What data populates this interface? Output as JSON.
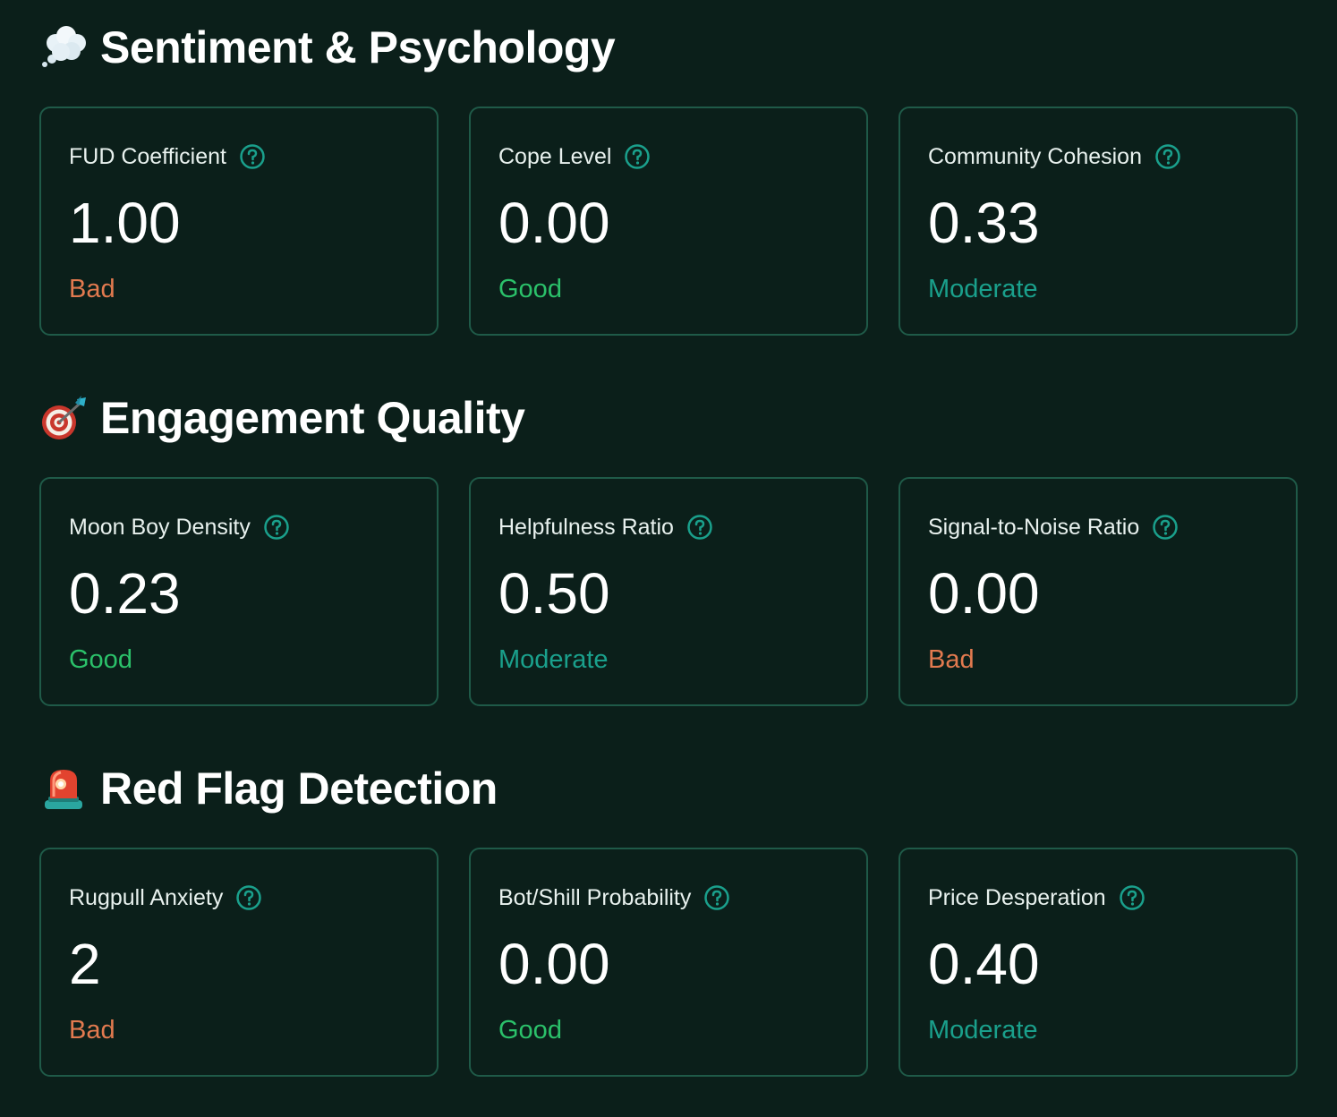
{
  "colors": {
    "background": "#0b1f1a",
    "card_border": "#1f5a48",
    "help_icon": "#1aa08c",
    "status_bad": "#e27a4f",
    "status_good": "#2bc16a",
    "status_moderate": "#1aa08c"
  },
  "sections": [
    {
      "icon": "thought-balloon-icon",
      "title": "Sentiment & Psychology",
      "cards": [
        {
          "label": "FUD Coefficient",
          "value": "1.00",
          "status": "Bad",
          "status_type": "bad"
        },
        {
          "label": "Cope Level",
          "value": "0.00",
          "status": "Good",
          "status_type": "good"
        },
        {
          "label": "Community Cohesion",
          "value": "0.33",
          "status": "Moderate",
          "status_type": "moderate"
        }
      ]
    },
    {
      "icon": "bullseye-dart-icon",
      "title": "Engagement Quality",
      "cards": [
        {
          "label": "Moon Boy Density",
          "value": "0.23",
          "status": "Good",
          "status_type": "good"
        },
        {
          "label": "Helpfulness Ratio",
          "value": "0.50",
          "status": "Moderate",
          "status_type": "moderate"
        },
        {
          "label": "Signal-to-Noise Ratio",
          "value": "0.00",
          "status": "Bad",
          "status_type": "bad"
        }
      ]
    },
    {
      "icon": "police-siren-icon",
      "title": "Red Flag Detection",
      "cards": [
        {
          "label": "Rugpull Anxiety",
          "value": "2",
          "status": "Bad",
          "status_type": "bad"
        },
        {
          "label": "Bot/Shill Probability",
          "value": "0.00",
          "status": "Good",
          "status_type": "good"
        },
        {
          "label": "Price Desperation",
          "value": "0.40",
          "status": "Moderate",
          "status_type": "moderate"
        }
      ]
    }
  ]
}
